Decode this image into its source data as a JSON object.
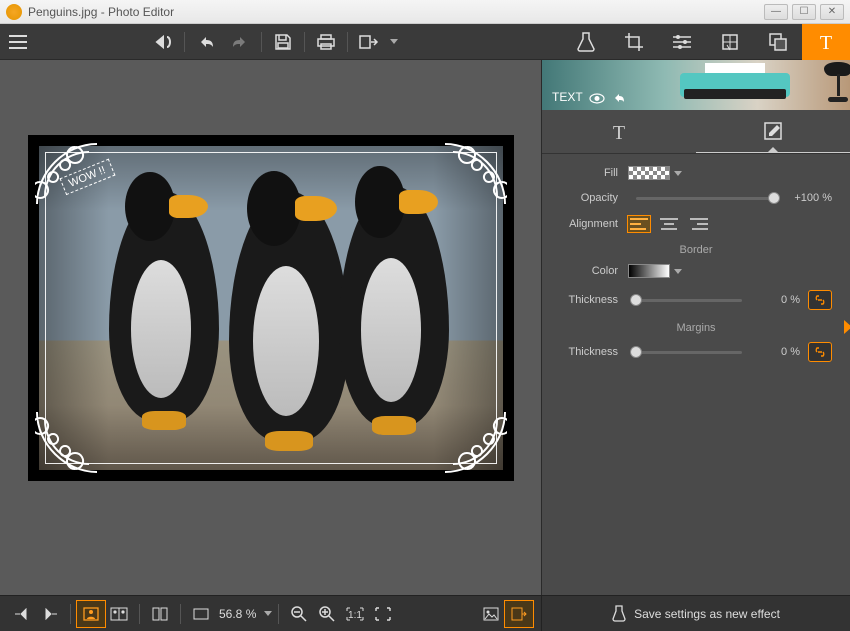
{
  "titlebar": {
    "title": "Penguins.jpg - Photo Editor"
  },
  "panel": {
    "banner_label": "TEXT",
    "labels": {
      "fill": "Fill",
      "opacity": "Opacity",
      "alignment": "Alignment",
      "border": "Border",
      "color": "Color",
      "thickness": "Thickness",
      "margins": "Margins"
    },
    "opacity_value": "+100 %",
    "border_thickness_value": "0 %",
    "margins_thickness_value": "0 %"
  },
  "statusbar": {
    "zoom": "56.8 %"
  },
  "bottom_right": {
    "save_label": "Save settings as new effect"
  },
  "canvas": {
    "wow_text": "WOW !!"
  }
}
